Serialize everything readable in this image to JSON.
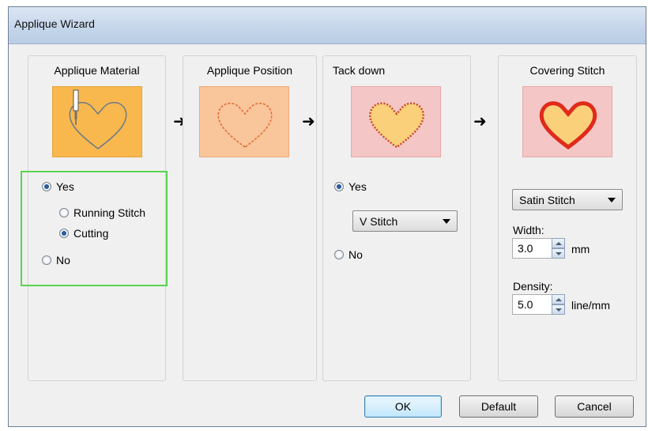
{
  "window": {
    "title": "Applique Wizard"
  },
  "panels": [
    {
      "title": "Applique Material"
    },
    {
      "title": "Applique Position"
    },
    {
      "title": "Tack down"
    },
    {
      "title": "Covering Stitch"
    }
  ],
  "icons": {
    "arrow": "right-arrow-icon"
  },
  "material": {
    "yes_label": "Yes",
    "running_stitch_label": "Running Stitch",
    "cutting_label": "Cutting",
    "no_label": "No",
    "selected": "Yes",
    "sub_selected": "Cutting"
  },
  "tackdown": {
    "yes_label": "Yes",
    "no_label": "No",
    "selected": "Yes",
    "stitch_value": "V Stitch"
  },
  "covering": {
    "stitch_value": "Satin Stitch",
    "width_label": "Width:",
    "width_value": "3.0",
    "width_unit": "mm",
    "density_label": "Density:",
    "density_value": "5.0",
    "density_unit": "line/mm"
  },
  "buttons": {
    "ok": "OK",
    "default": "Default",
    "cancel": "Cancel"
  },
  "colors": {
    "highlight_border": "#5ad44f",
    "orange_thumb": "#f8b84e",
    "peach_thumb": "#f9c59a",
    "pink_thumb": "#f4c6c6"
  }
}
